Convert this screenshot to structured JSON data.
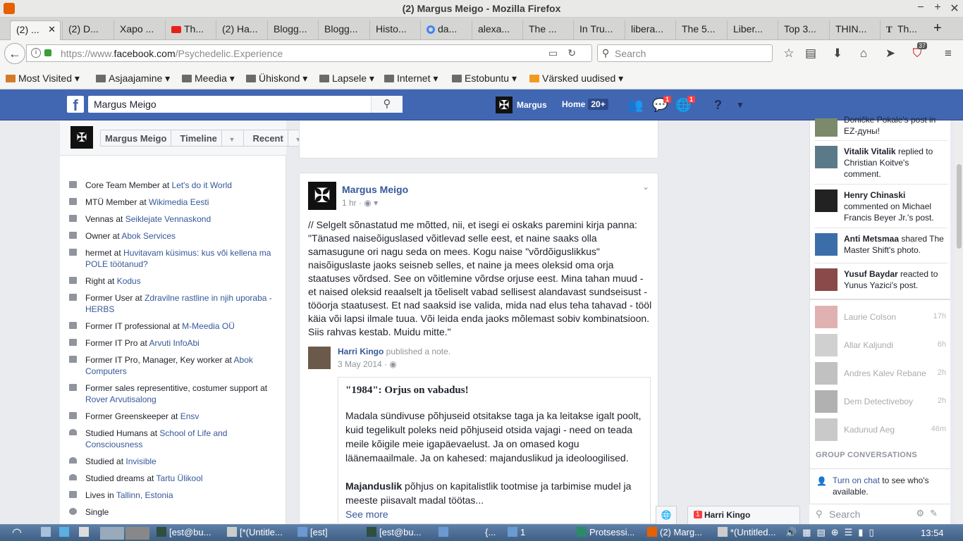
{
  "window": {
    "title": "(2) Margus Meigo - Mozilla Firefox"
  },
  "tabs": [
    {
      "label": "(2) ..."
    },
    {
      "label": "(2) D..."
    },
    {
      "label": "Xapo ..."
    },
    {
      "label": "Th..."
    },
    {
      "label": "(2) Ha..."
    },
    {
      "label": "Blogg..."
    },
    {
      "label": "Blogg..."
    },
    {
      "label": "Histo..."
    },
    {
      "label": "da..."
    },
    {
      "label": "alexa..."
    },
    {
      "label": "The ..."
    },
    {
      "label": "In Tru..."
    },
    {
      "label": "libera..."
    },
    {
      "label": "The 5..."
    },
    {
      "label": "Liber..."
    },
    {
      "label": "Top 3..."
    },
    {
      "label": "THIN..."
    },
    {
      "label": "Th..."
    }
  ],
  "nav": {
    "url_prefix": "https://www.",
    "url_domain": "facebook.com",
    "url_path": "/Psychedelic.Experience",
    "search_placeholder": "Search",
    "badge_count": "37"
  },
  "bookmarks": [
    {
      "label": "Most Visited ▾"
    },
    {
      "label": "Asjaajamine ▾"
    },
    {
      "label": "Meedia ▾"
    },
    {
      "label": "Ühiskond ▾"
    },
    {
      "label": "Lapsele ▾"
    },
    {
      "label": "Internet ▾"
    },
    {
      "label": "Estobuntu ▾"
    },
    {
      "label": "Värsked uudised ▾"
    }
  ],
  "fb": {
    "search_value": "Margus Meigo",
    "user_name": "Margus",
    "home_label": "Home",
    "home_count": "20+",
    "messages_badge": "1",
    "notif_badge": "1"
  },
  "profile_header": {
    "name": "Margus Meigo",
    "timeline": "Timeline",
    "recent": "Recent"
  },
  "intro": [
    {
      "text": "Core Team Member at ",
      "link": "Let's do it World",
      "icon": "work"
    },
    {
      "text": "MTÜ Member at ",
      "link": "Wikimedia Eesti",
      "icon": "work"
    },
    {
      "text": "Vennas at ",
      "link": "Seiklejate Vennaskond",
      "icon": "work"
    },
    {
      "text": "Owner at ",
      "link": "Abok Services",
      "icon": "work"
    },
    {
      "text": "hermet at ",
      "link": "Huvitavam küsimus: kus või kellena ma POLE töötanud?",
      "icon": "work"
    },
    {
      "text": "Right at ",
      "link": "Kodus",
      "icon": "work"
    },
    {
      "text": "Former User at ",
      "link": "Zdravilne rastline in njih uporaba - HERBS",
      "icon": "work"
    },
    {
      "text": "Former IT professional at ",
      "link": "M-Meedia OÜ",
      "icon": "work"
    },
    {
      "text": "Former IT Pro at ",
      "link": "Arvuti InfoAbi",
      "icon": "work"
    },
    {
      "text": "Former IT Pro, Manager, Key worker at ",
      "link": "Abok Computers",
      "icon": "work"
    },
    {
      "text": "Former sales representitive, costumer support at ",
      "link": "Rover Arvutisalong",
      "icon": "work"
    },
    {
      "text": "Former Greenskeeper at ",
      "link": "Ensv",
      "icon": "work"
    },
    {
      "text": "Studied Humans at ",
      "link": "School of Life and Consciousness",
      "icon": "edu"
    },
    {
      "text": "Studied at ",
      "link": "Invisible",
      "icon": "edu"
    },
    {
      "text": "Studied dreams at ",
      "link": "Tartu Ülikool",
      "icon": "edu"
    },
    {
      "text": "Lives in ",
      "link": "Tallinn, Estonia",
      "icon": "home"
    },
    {
      "text": "Single",
      "link": "",
      "icon": "heart"
    }
  ],
  "post": {
    "author": "Margus Meigo",
    "time": "1 hr · ",
    "text": "// Selgelt sõnastatud me mõtted, nii, et isegi ei oskaks paremini kirja panna: \"Tänased naiseõiguslased võitlevad selle eest, et naine saaks olla samasugune ori nagu seda on mees. Kogu naise \"võrdõiguslikkus\" naisõiguslaste jaoks seisneb selles, et naine ja mees oleksid oma orja staatuses võrdsed. See on võitlemine võrdse orjuse eest. Mina tahan muud - et naised oleksid reaalselt ja tõeliselt vabad sellisest alandavast sundseisust - tööorja staatusest. Et nad saaksid ise valida, mida nad elus teha tahavad - tööl käia või lapsi ilmale tuua. Või leida enda jaoks mõlemast sobiv kombinatsioon. Siis rahvas kestab. Muidu mitte.\"",
    "shared_author": "Harri Kingo",
    "shared_action": " published a note.",
    "shared_time": "3 May 2014 · ",
    "note_title": "\"1984\": Orjus on vabadus!",
    "note_body": "Madala sündivuse põhjuseid otsitakse taga ja ka leitakse igalt poolt, kuid tegelikult poleks neid põhjuseid otsida vajagi - need on teada meile kõigile meie igapäevaelust. Ja on omased kogu läänemaailmale. Ja on kahesed: majanduslikud ja ideoloogilised.",
    "note_bold": "Majanduslik",
    "note_body2": " põhjus on kapitalistlik tootmise ja tarbimise mudel ja meeste piisavalt madal töötas...",
    "see_more": "See more"
  },
  "ticker": [
    {
      "name": "",
      "action": "Doničke Pokale's post in EZ-дуны!"
    },
    {
      "name": "Vitalik Vitalik",
      "action": " replied to Christian Koitve's comment."
    },
    {
      "name": "Henry Chinaski",
      "action": " commented on Michael Francis Beyer Jr.'s post."
    },
    {
      "name": "Anti Metsmaa",
      "action": " shared The Master Shift's photo."
    },
    {
      "name": "Yusuf Baydar",
      "action": " reacted to Yunus Yazici's post."
    }
  ],
  "chat": [
    {
      "name": "Laurie Colson",
      "time": "17h"
    },
    {
      "name": "Allar Kaljundi",
      "time": "6h"
    },
    {
      "name": "Andres Kalev Rebane",
      "time": "2h"
    },
    {
      "name": "Dem Detectiveboy",
      "time": "2h"
    },
    {
      "name": "Kadunud Aeg",
      "time": "46m"
    }
  ],
  "chat_footer": {
    "group_heading": "GROUP CONVERSATIONS",
    "turn_on_link": "Turn on chat",
    "turn_on_text": " to see who's available.",
    "search_placeholder": "Search",
    "tab_name": "Harri Kingo",
    "tab_count": "1"
  },
  "taskbar": [
    {
      "label": "[est@bu..."
    },
    {
      "label": "[*(Untitle..."
    },
    {
      "label": "[est]"
    },
    {
      "label": "[est@bu..."
    },
    {
      "label": "{..."
    },
    {
      "label": "1"
    },
    {
      "label": "Protsessi..."
    },
    {
      "label": "(2) Marg..."
    },
    {
      "label": "*(Untitled..."
    }
  ],
  "clock": "13:54",
  "colors": {
    "fb_blue": "#4267b2",
    "link": "#365899"
  }
}
